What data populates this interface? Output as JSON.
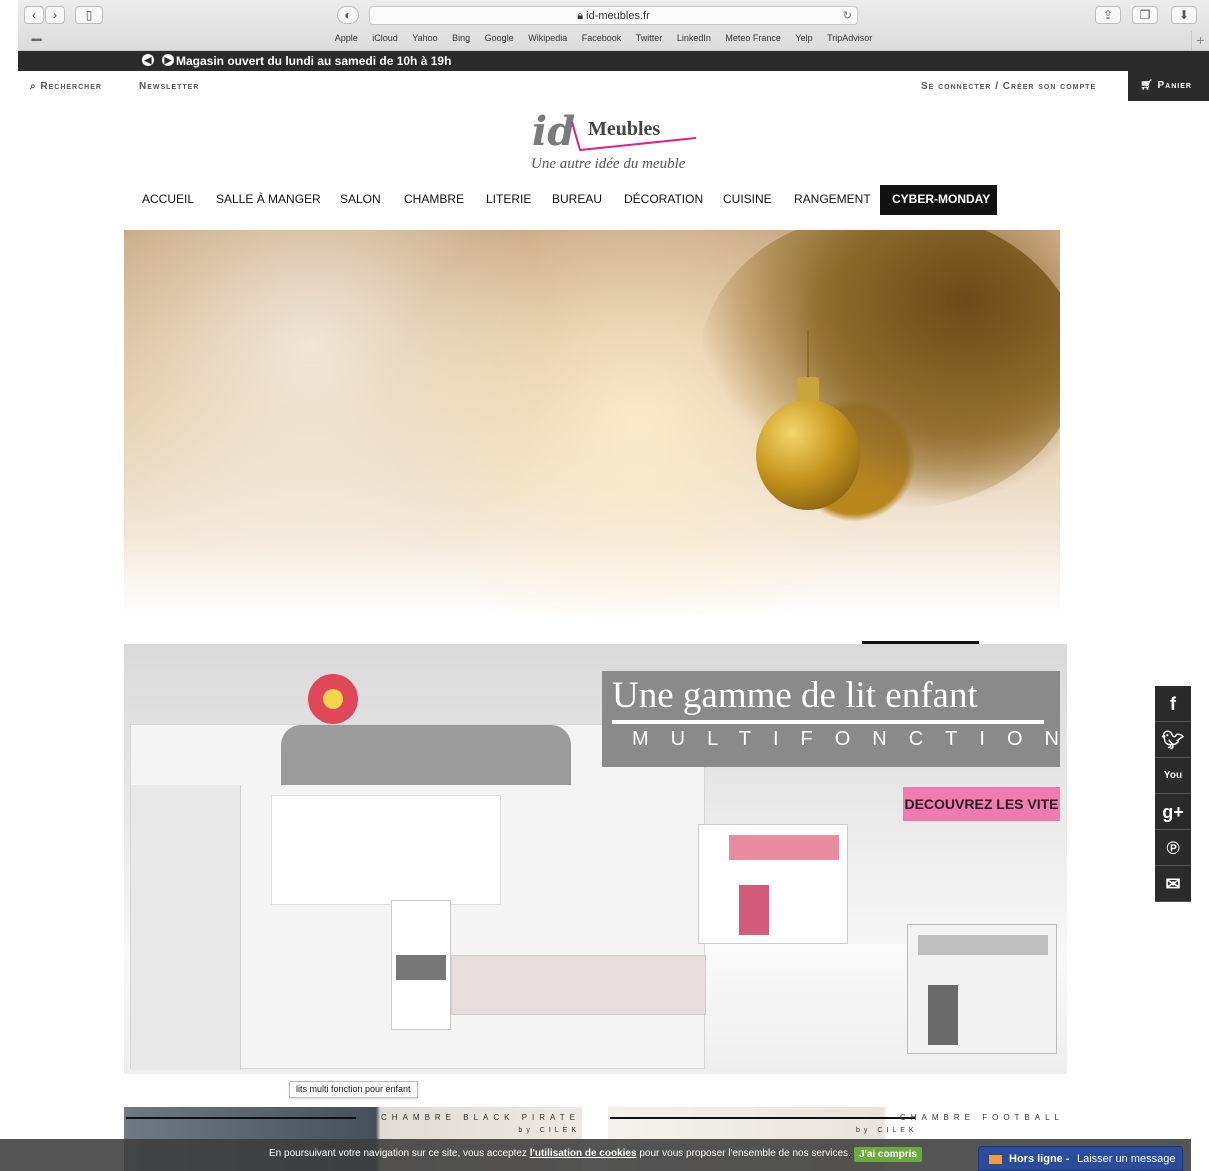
{
  "browser": {
    "url": "id-meubles.fr",
    "bookmarks": [
      "Apple",
      "iCloud",
      "Yahoo",
      "Bing",
      "Google",
      "Wikipedia",
      "Facebook",
      "Twitter",
      "LinkedIn",
      "Meteo France",
      "Yelp",
      "TripAdvisor"
    ]
  },
  "topbar": {
    "message": "Magasin ouvert du lundi au samedi de 10h à 19h"
  },
  "util": {
    "search": "Rechercher",
    "newsletter": "Newsletter",
    "account": "Se connecter / Créer son compte",
    "cart": "Panier"
  },
  "logo": {
    "id": "id",
    "name": "Meubles",
    "tagline": "Une autre idée du meuble"
  },
  "nav": [
    {
      "label": "ACCUEIL"
    },
    {
      "label": "SALLE À MANGER"
    },
    {
      "label": "SALON"
    },
    {
      "label": "CHAMBRE"
    },
    {
      "label": "LITERIE"
    },
    {
      "label": "BUREAU"
    },
    {
      "label": "DÉCORATION"
    },
    {
      "label": "CUISINE"
    },
    {
      "label": "RANGEMENT"
    },
    {
      "label": "CYBER-MONDAY"
    }
  ],
  "promo": {
    "headline": "Une gamme de lit enfant",
    "subhead": "MULTIFONCTION",
    "cta": "DECOUVREZ LES VITE",
    "tooltip": "lits multi fonction pour enfant"
  },
  "thumbs": [
    {
      "caption": "CHAMBRE BLACK PIRATE",
      "sub": "by CILEK"
    },
    {
      "caption": "CHAMBRE FOOTBALL",
      "sub": "by CILEK"
    }
  ],
  "cookie": {
    "before": "En poursuivant votre navigation sur ce site, vous acceptez ",
    "link": "l'utilisation de cookies",
    "after": " pour vous proposer l'ensemble de nos services.",
    "ok": "J'ai compris"
  },
  "chat": {
    "status": "Hors ligne -",
    "action": "Laisser un message"
  },
  "social": [
    "facebook-icon",
    "twitter-icon",
    "youtube-icon",
    "googleplus-icon",
    "pinterest-icon",
    "mail-icon"
  ]
}
